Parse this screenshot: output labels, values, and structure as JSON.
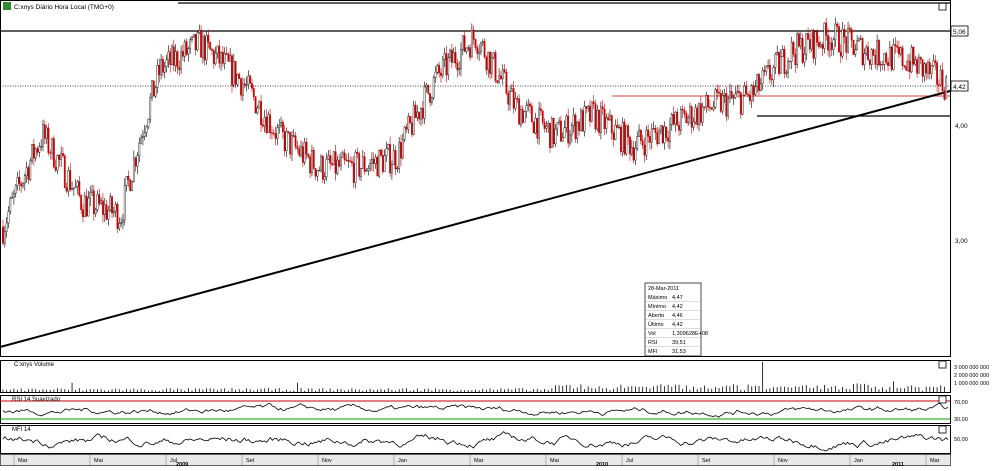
{
  "main_chart": {
    "title": "C:xnys Diário Hora Local (TMG+0)",
    "y_scale": "log",
    "y_ticks": [
      "3,00",
      "4,00"
    ],
    "right_labels": [
      "5,06",
      "4,42"
    ],
    "horizontal_lines": [
      5.06,
      4.42
    ],
    "x_months": [
      "Mar",
      "Mai",
      "Jul",
      "Set",
      "Nov",
      "Jan",
      "Mar",
      "Mai",
      "Jul",
      "Set",
      "Nov",
      "Jan",
      "Mar"
    ],
    "years": [
      "2009",
      "2010",
      "2011"
    ]
  },
  "tooltip": {
    "date": "28-Mar-2011",
    "rows": [
      {
        "label": "Máximo",
        "value": "4,47"
      },
      {
        "label": "Mínimo",
        "value": "4,42"
      },
      {
        "label": "Aberto",
        "value": "4,46"
      },
      {
        "label": "Último",
        "value": "4,42"
      },
      {
        "label": "Vol",
        "value": "1,309628E+08"
      },
      {
        "label": "RSI",
        "value": "39,51"
      },
      {
        "label": "MFI",
        "value": "31,53"
      }
    ]
  },
  "volume_panel": {
    "title": "C:xnys Volume",
    "ticks": [
      "3 000 000 000",
      "2 000 000 000",
      "1 000 000 000"
    ]
  },
  "rsi_panel": {
    "title": "RSI 14 Suavizado",
    "ticks": [
      "70,00",
      "30,00"
    ],
    "upper_level": 70,
    "lower_level": 30
  },
  "mfi_panel": {
    "title": "MFI 14",
    "ticks": [
      "50,00"
    ]
  },
  "colors": {
    "up": "#000000",
    "down": "#c80000",
    "rsi_upper": "#c80000",
    "rsi_lower": "#00a000"
  },
  "chart_data": {
    "type": "candlestick",
    "y_scale": "log",
    "x": [
      "2009-03",
      "2009-04",
      "2009-05",
      "2009-06",
      "2009-07",
      "2009-08",
      "2009-09",
      "2009-10",
      "2009-11",
      "2009-12",
      "2010-01",
      "2010-02",
      "2010-03",
      "2010-04",
      "2010-05",
      "2010-06",
      "2010-07",
      "2010-08",
      "2010-09",
      "2010-10",
      "2010-11",
      "2010-12",
      "2011-01",
      "2011-02",
      "2011-03"
    ],
    "close": [
      3.1,
      3.9,
      3.3,
      3.2,
      4.6,
      4.9,
      4.5,
      3.9,
      3.6,
      3.6,
      3.7,
      4.5,
      5.0,
      4.2,
      3.9,
      4.1,
      3.8,
      4.0,
      4.2,
      4.3,
      4.8,
      5.0,
      4.8,
      4.7,
      4.42
    ],
    "last_bar": {
      "date": "28-Mar-2011",
      "open": 4.46,
      "high": 4.47,
      "low": 4.42,
      "close": 4.42,
      "volume": 130962800,
      "rsi": 39.51,
      "mfi": 31.53
    }
  }
}
